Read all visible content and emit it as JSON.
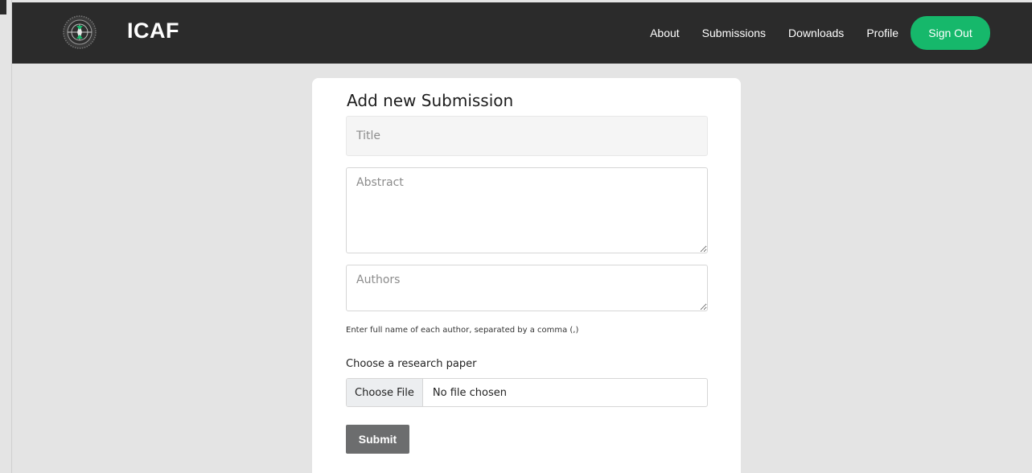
{
  "nav": {
    "brand": "ICAF",
    "links": [
      "About",
      "Submissions",
      "Downloads",
      "Profile"
    ],
    "signout_label": "Sign Out"
  },
  "colors": {
    "navbar_bg": "#2b2b2b",
    "accent_green": "#16b86b",
    "page_bg": "#e4e4e4",
    "submit_bg": "#6c6d6e"
  },
  "form": {
    "heading": "Add new Submission",
    "title_placeholder": "Title",
    "abstract_placeholder": "Abstract",
    "authors_placeholder": "Authors",
    "authors_helper": "Enter full name of each author, separated by a comma (,)",
    "file_label": "Choose a research paper",
    "file_button_label": "Choose File",
    "file_status": "No file chosen",
    "submit_label": "Submit"
  },
  "icons": {
    "logo": "compass-logo-icon"
  }
}
